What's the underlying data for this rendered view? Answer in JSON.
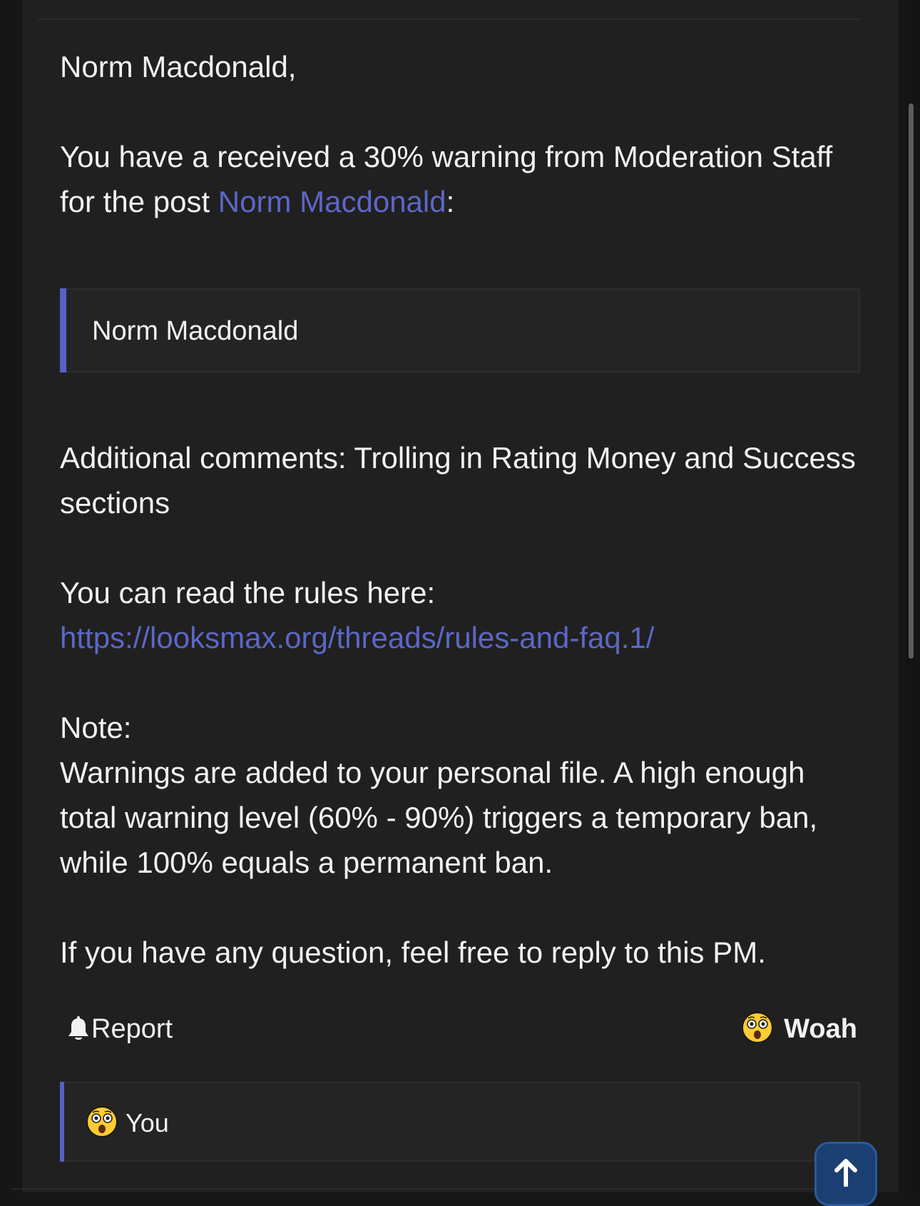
{
  "colors": {
    "page_background": "#161616",
    "panel_background": "#202020",
    "text": "#f2f2f2",
    "link": "#5b67c7",
    "quote_accent": "#5661c3",
    "scroll_button": "#1b3f73"
  },
  "message": {
    "greeting": "Norm Macdonald,",
    "warning_line_prefix": "You have a received a 30% warning from Moderation Staff for the post ",
    "post_link_label": "Norm Macdonald",
    "warning_line_suffix": ":",
    "quote_text": "Norm Macdonald",
    "additional_comments": "Additional comments: Trolling in Rating Money and Success sections",
    "rules_intro": "You can read the rules here:",
    "rules_url": "https://looksmax.org/threads/rules-and-faq.1/",
    "note_heading": "Note:",
    "note_body": "Warnings are added to your personal file. A high enough total warning level (60% - 90%) triggers a temporary ban, while 100% equals a permanent ban.",
    "closing": "If you have any question, feel free to reply to this PM."
  },
  "actions": {
    "report_label": "Report",
    "report_icon": "bell-icon",
    "reaction_label": "Woah",
    "reaction_icon": "astonished-face-emoji"
  },
  "reactions_bar": {
    "icon": "astonished-face-emoji",
    "user": "You"
  },
  "scroll_top": {
    "icon": "arrow-up-icon"
  }
}
